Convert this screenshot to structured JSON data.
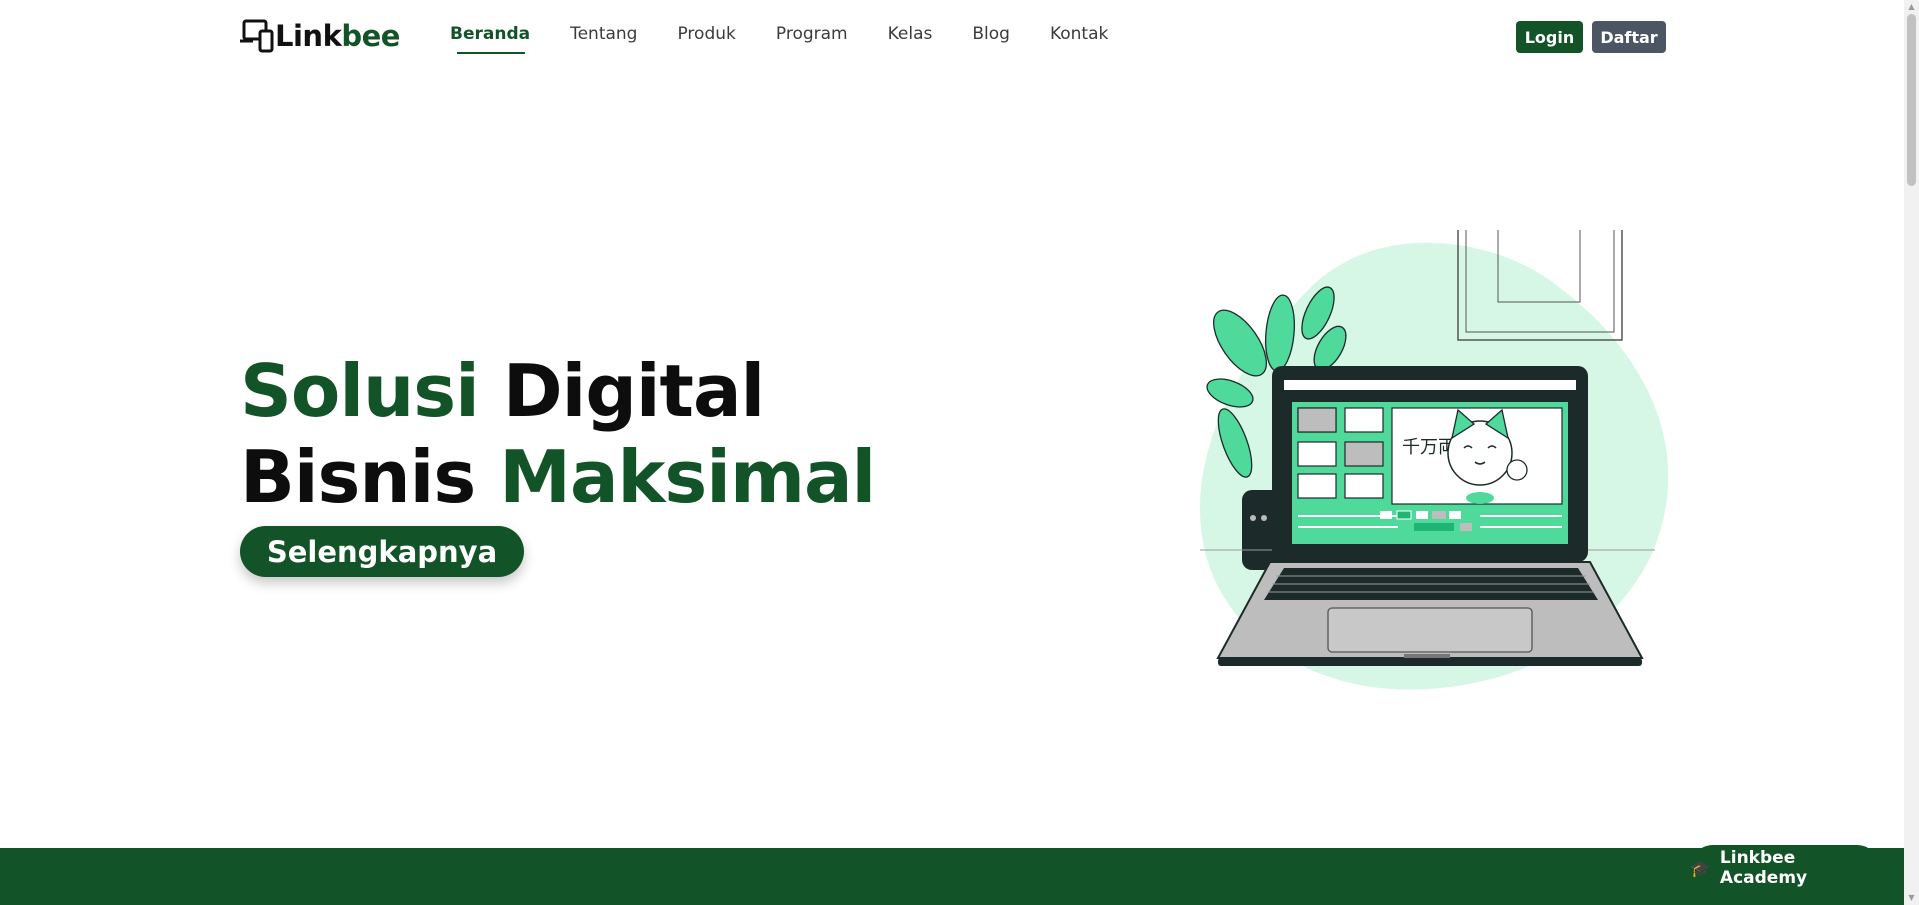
{
  "brand": {
    "name_part1": "Link",
    "name_part2": "bee",
    "logo_icon": "devices-icon"
  },
  "nav": {
    "items": [
      {
        "label": "Beranda",
        "active": true
      },
      {
        "label": "Tentang",
        "active": false
      },
      {
        "label": "Produk",
        "active": false
      },
      {
        "label": "Program",
        "active": false
      },
      {
        "label": "Kelas",
        "active": false
      },
      {
        "label": "Blog",
        "active": false
      },
      {
        "label": "Kontak",
        "active": false
      }
    ]
  },
  "auth": {
    "login_label": "Login",
    "register_label": "Daftar"
  },
  "hero": {
    "title_line1_green": "Solusi",
    "title_line1_dark": "Digital",
    "title_line2_dark": "Bisnis",
    "title_line2_green": "Maksimal",
    "cta_label": "Selengkapnya",
    "illustration_kanji": "千万両"
  },
  "floating_button": {
    "label": "Linkbee Academy",
    "icon": "graduation-cap-icon"
  },
  "colors": {
    "brand_green": "#125328",
    "accent_green": "#4fd99b",
    "blob_green": "#d6f7e6",
    "button_gray": "#4b5563"
  }
}
